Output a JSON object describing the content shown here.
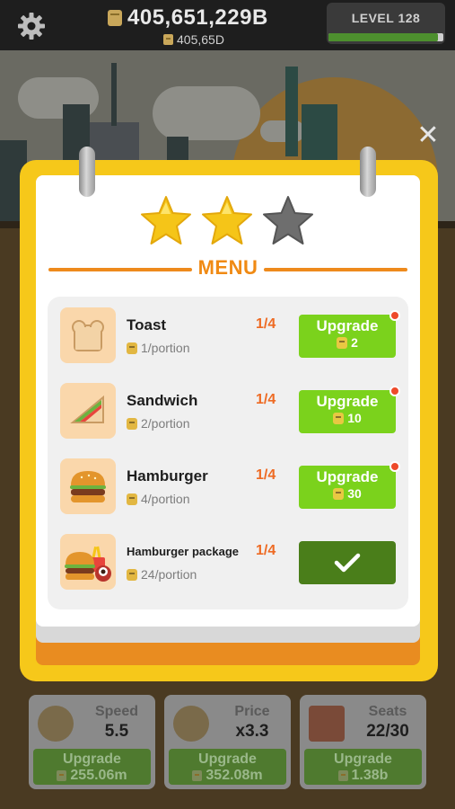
{
  "header": {
    "money_main": "405,651,229B",
    "money_sub": "405,65D",
    "level_label": "LEVEL 128",
    "level_progress": 0.95
  },
  "dialog": {
    "title": "MENU",
    "stars_filled": 2,
    "stars_total": 3,
    "items": [
      {
        "name": "Toast",
        "portion": "1/portion",
        "count": "1/4",
        "button_label": "Upgrade",
        "button_cost": "2",
        "state": "upgrade",
        "icon": "toast-icon"
      },
      {
        "name": "Sandwich",
        "portion": "2/portion",
        "count": "1/4",
        "button_label": "Upgrade",
        "button_cost": "10",
        "state": "upgrade",
        "icon": "sandwich-icon"
      },
      {
        "name": "Hamburger",
        "portion": "4/portion",
        "count": "1/4",
        "button_label": "Upgrade",
        "button_cost": "30",
        "state": "upgrade",
        "icon": "hamburger-icon"
      },
      {
        "name": "Hamburger package",
        "portion": "24/portion",
        "count": "1/4",
        "state": "done",
        "icon": "hamburger-package-icon"
      }
    ]
  },
  "stats": [
    {
      "name": "Speed",
      "value": "5.5",
      "button_label": "Upgrade",
      "button_cost": "255.06m",
      "icon": "stopwatch-icon"
    },
    {
      "name": "Price",
      "value": "x3.3",
      "button_label": "Upgrade",
      "button_cost": "352.08m",
      "icon": "money-bag-icon"
    },
    {
      "name": "Seats",
      "value": "22/30",
      "button_label": "Upgrade",
      "button_cost": "1.38b",
      "icon": "sofa-icon"
    }
  ],
  "colors": {
    "modal_frame": "#f6c81a",
    "menu_title": "#f08a14",
    "count_text": "#ee6b24",
    "upgrade_button": "#7bd21c",
    "done_button": "#4a7e1a",
    "notification_dot": "#ee4a2a"
  }
}
